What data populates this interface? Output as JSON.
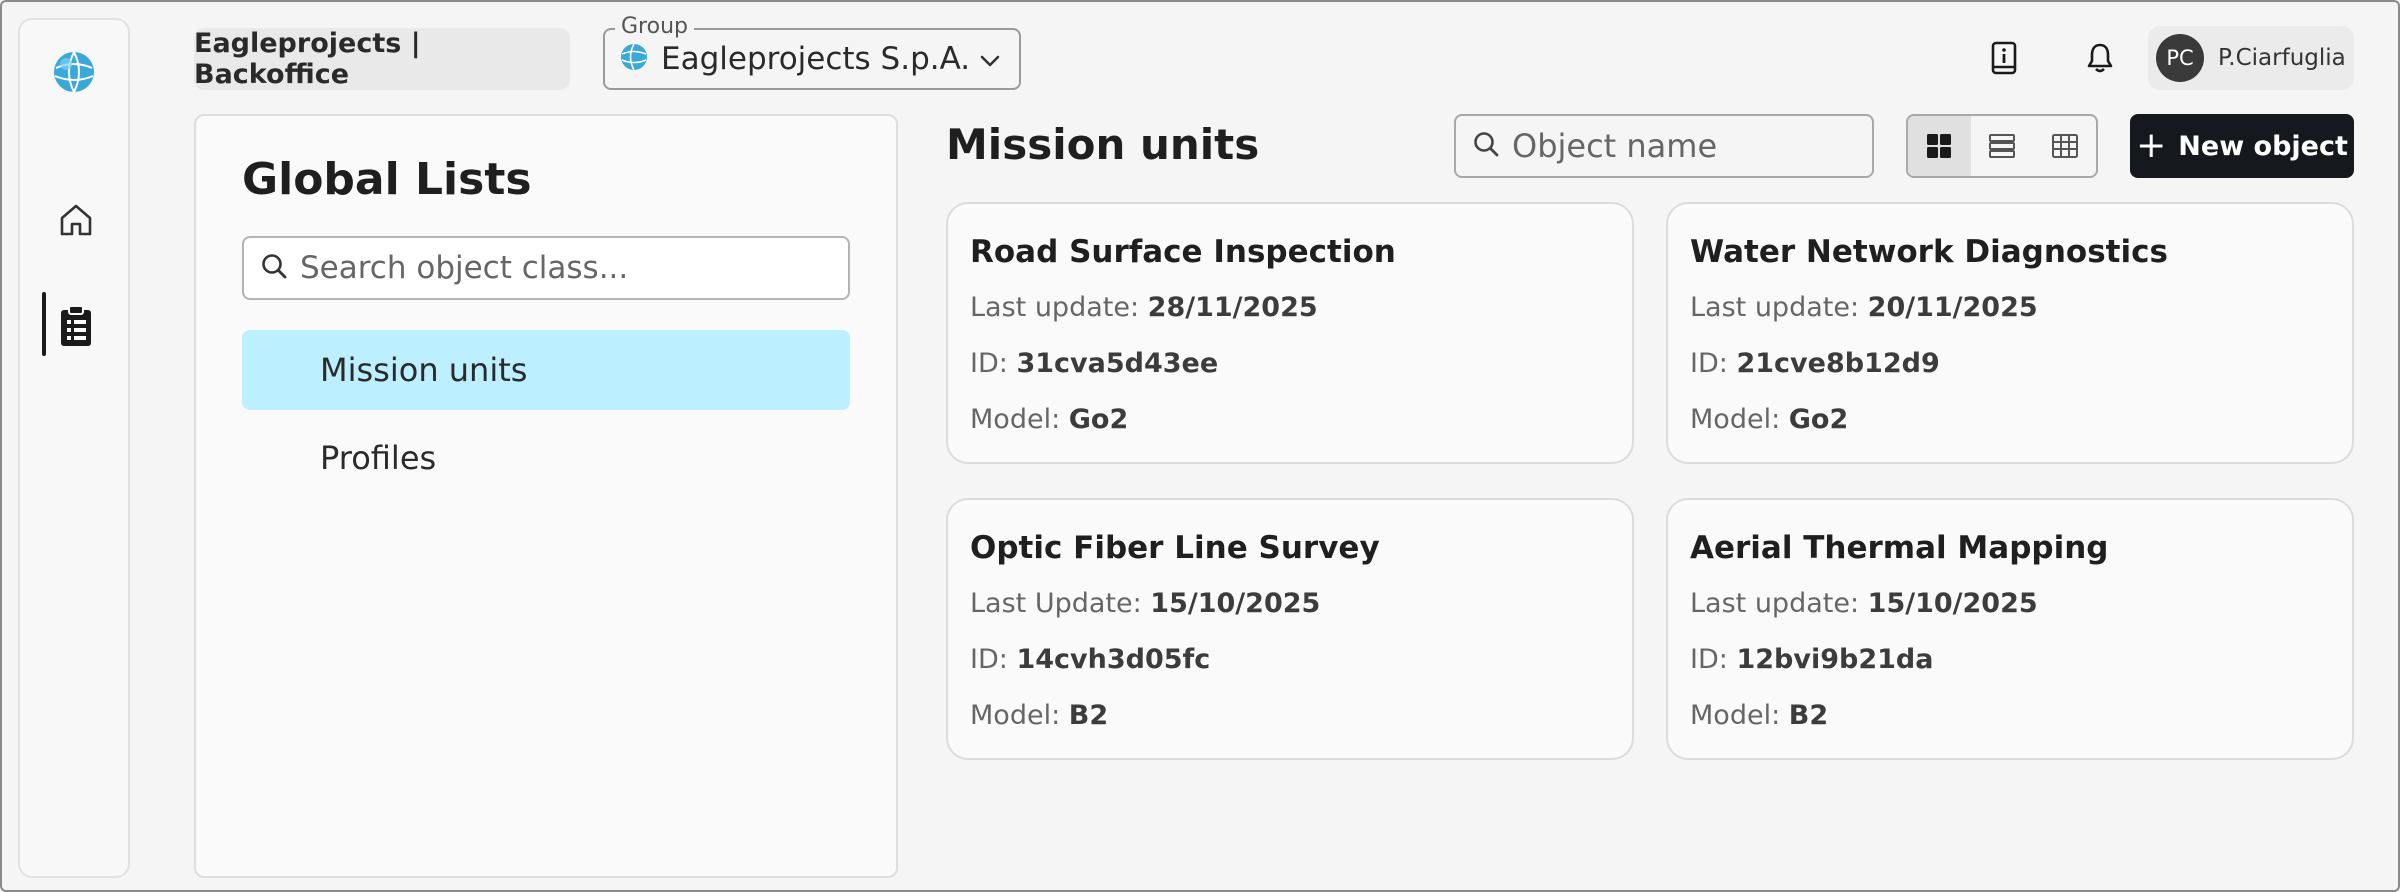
{
  "header": {
    "app_name": "Eagleprojects | Backoffice",
    "group_label": "Group",
    "group_value": "Eagleprojects S.p.A.",
    "user_initials": "PC",
    "user_name": "P.Ciarfuglia"
  },
  "sidebar_panel": {
    "title": "Global Lists",
    "search_placeholder": "Search object class...",
    "items": [
      {
        "label": "Mission units",
        "active": true
      },
      {
        "label": "Profiles",
        "active": false
      }
    ]
  },
  "main": {
    "title": "Mission units",
    "search_placeholder": "Object name",
    "new_button_label": "New object",
    "view_mode": "grid",
    "cards": [
      {
        "title": "Road Surface Inspection",
        "update_label": "Last update:",
        "update_value": "28/11/2025",
        "id_label": "ID:",
        "id_value": "31cva5d43ee",
        "model_label": "Model:",
        "model_value": "Go2"
      },
      {
        "title": "Water Network Diagnostics",
        "update_label": "Last update:",
        "update_value": "20/11/2025",
        "id_label": "ID:",
        "id_value": "21cve8b12d9",
        "model_label": "Model:",
        "model_value": "Go2"
      },
      {
        "title": "Optic Fiber Line Survey",
        "update_label": "Last Update:",
        "update_value": "15/10/2025",
        "id_label": "ID:",
        "id_value": "14cvh3d05fc",
        "model_label": "Model:",
        "model_value": "B2"
      },
      {
        "title": "Aerial Thermal Mapping",
        "update_label": "Last update:",
        "update_value": "15/10/2025",
        "id_label": "ID:",
        "id_value": "12bvi9b21da",
        "model_label": "Model:",
        "model_value": "B2"
      }
    ]
  },
  "icons": {
    "logo": "globe-logo-icon",
    "home": "home-icon",
    "lists": "clipboard-list-icon",
    "docs": "book-info-icon",
    "notifications": "bell-icon",
    "search": "search-icon",
    "chevron": "chevron-down-icon",
    "grid": "grid-view-icon",
    "list": "list-view-icon",
    "table": "table-view-icon",
    "plus": "plus-icon"
  },
  "colors": {
    "active_item_bg": "#bcefff",
    "primary_button_bg": "#15191d",
    "logo_blue": "#3aa8d8"
  }
}
